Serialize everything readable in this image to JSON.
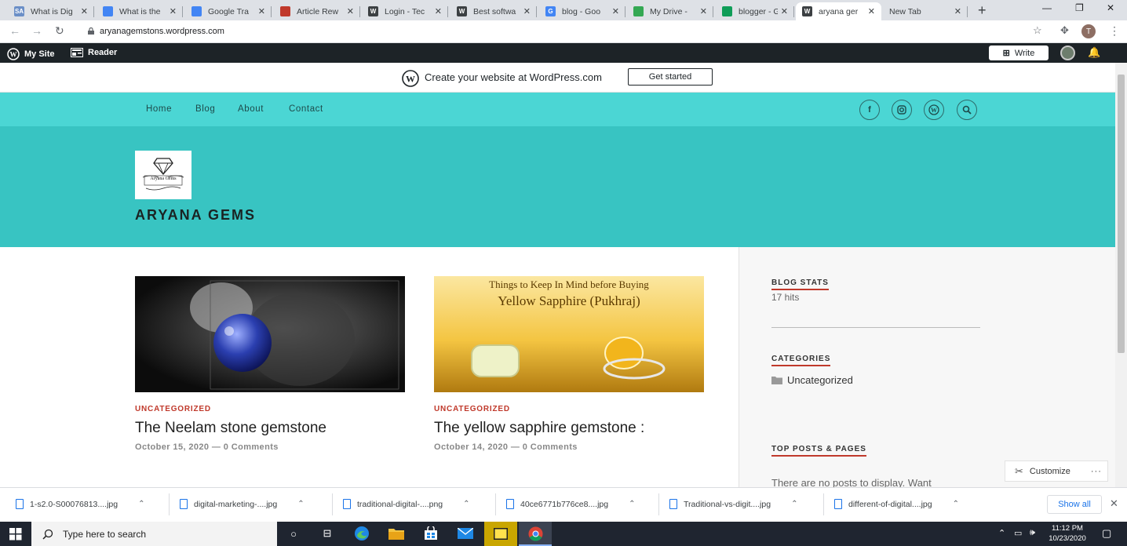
{
  "browser": {
    "tabs": [
      {
        "title": "What is Dig",
        "favicon": "SA",
        "color": "#6b8fc7"
      },
      {
        "title": "What is the",
        "favicon": "docs",
        "color": "#4285f4"
      },
      {
        "title": "Google Tra",
        "favicon": "translate",
        "color": "#4285f4"
      },
      {
        "title": "Article Rew",
        "favicon": "art",
        "color": "#c0392b"
      },
      {
        "title": "Login - Tec",
        "favicon": "W",
        "color": "#3c4043"
      },
      {
        "title": "Best softwa",
        "favicon": "W",
        "color": "#3c4043"
      },
      {
        "title": "blog - Goo",
        "favicon": "G",
        "color": "#4285f4"
      },
      {
        "title": "My Drive -",
        "favicon": "drive",
        "color": "#34a853"
      },
      {
        "title": "blogger - G",
        "favicon": "sheet",
        "color": "#0f9d58"
      },
      {
        "title": "aryana ger",
        "favicon": "W",
        "color": "#3c4043"
      },
      {
        "title": "New Tab",
        "favicon": "",
        "color": ""
      }
    ],
    "url": "aryanagemstons.wordpress.com",
    "profile_initial": "T"
  },
  "adminbar": {
    "my_site": "My Site",
    "reader": "Reader",
    "write": "Write"
  },
  "banner": {
    "text": "Create your website at WordPress.com",
    "button": "Get started"
  },
  "nav": {
    "links": [
      "Home",
      "Blog",
      "About",
      "Contact"
    ],
    "social": [
      "f",
      "ig",
      "W",
      "search"
    ]
  },
  "site": {
    "logo_text": "Aryana Gems",
    "title": "ARYANA GEMS"
  },
  "posts": [
    {
      "category": "UNCATEGORIZED",
      "title": "The Neelam stone gemstone",
      "meta": "October 15, 2020 — 0 Comments"
    },
    {
      "category": "UNCATEGORIZED",
      "title": "The yellow sapphire gemstone :",
      "meta": "October 14, 2020 — 0 Comments",
      "image_caption_1": "Things to Keep In Mind before Buying",
      "image_caption_2": "Yellow Sapphire (Pukhraj)"
    }
  ],
  "sidebar": {
    "blog_stats_title": "BLOG STATS",
    "blog_stats_value": "17 hits",
    "categories_title": "CATEGORIES",
    "category_item": "Uncategorized",
    "top_posts_title": "TOP POSTS & PAGES",
    "top_posts_text": "There are no posts to display. Want"
  },
  "customize": "Customize",
  "downloads": {
    "items": [
      "1-s2.0-S00076813....jpg",
      "digital-marketing-....jpg",
      "traditional-digital-....png",
      "40ce6771b776ce8....jpg",
      "Traditional-vs-digit....jpg",
      "different-of-digital....jpg"
    ],
    "show_all": "Show all"
  },
  "taskbar": {
    "search_placeholder": "Type here to search",
    "time": "11:12 PM",
    "date": "10/23/2020"
  }
}
